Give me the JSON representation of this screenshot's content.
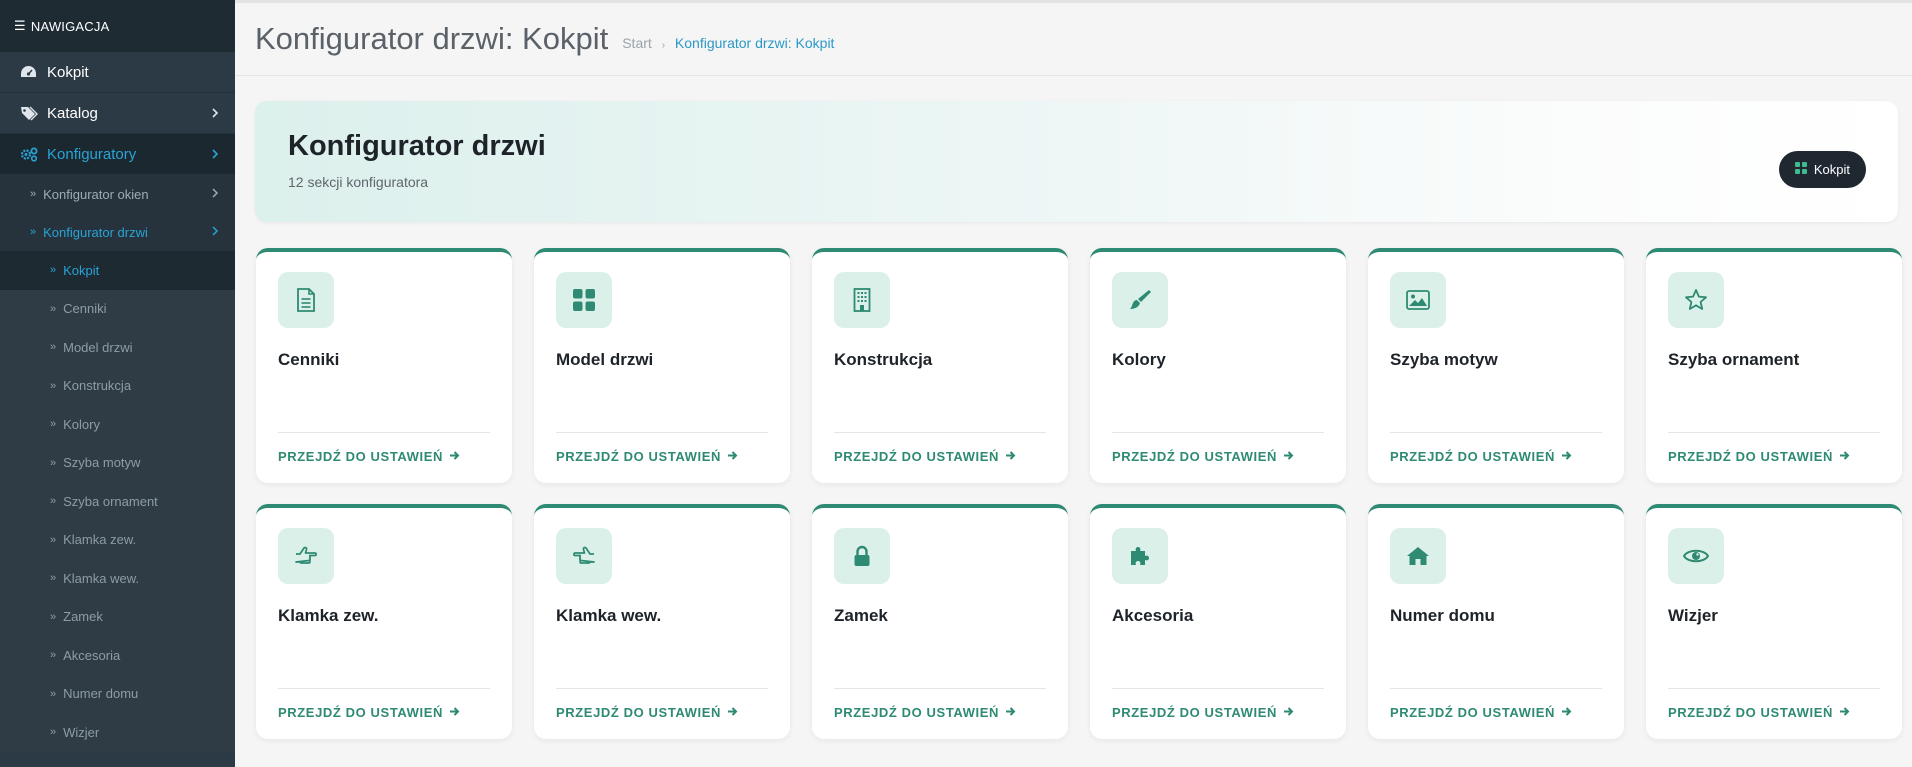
{
  "sidebar": {
    "header": "NAWIGACJA",
    "items": [
      {
        "label": "Kokpit"
      },
      {
        "label": "Katalog"
      },
      {
        "label": "Konfiguratory"
      }
    ],
    "sub_items": [
      {
        "label": "Konfigurator okien"
      },
      {
        "label": "Konfigurator drzwi"
      }
    ],
    "subsub_items": [
      {
        "label": "Kokpit"
      },
      {
        "label": "Cenniki"
      },
      {
        "label": "Model drzwi"
      },
      {
        "label": "Konstrukcja"
      },
      {
        "label": "Kolory"
      },
      {
        "label": "Szyba motyw"
      },
      {
        "label": "Szyba ornament"
      },
      {
        "label": "Klamka zew."
      },
      {
        "label": "Klamka wew."
      },
      {
        "label": "Zamek"
      },
      {
        "label": "Akcesoria"
      },
      {
        "label": "Numer domu"
      },
      {
        "label": "Wizjer"
      }
    ]
  },
  "header": {
    "title": "Konfigurator drzwi: Kokpit",
    "breadcrumb": {
      "home": "Start",
      "current": "Konfigurator drzwi: Kokpit"
    }
  },
  "hero": {
    "title": "Konfigurator drzwi",
    "subtitle": "12 sekcji konfiguratora",
    "button_label": "Kokpit"
  },
  "cards": [
    {
      "title": "Cenniki",
      "icon": "document-icon",
      "link": "PRZEJDŹ DO USTAWIEŃ"
    },
    {
      "title": "Model drzwi",
      "icon": "grid-icon",
      "link": "PRZEJDŹ DO USTAWIEŃ"
    },
    {
      "title": "Konstrukcja",
      "icon": "building-icon",
      "link": "PRZEJDŹ DO USTAWIEŃ"
    },
    {
      "title": "Kolory",
      "icon": "paintbrush-icon",
      "link": "PRZEJDŹ DO USTAWIEŃ"
    },
    {
      "title": "Szyba motyw",
      "icon": "image-icon",
      "link": "PRZEJDŹ DO USTAWIEŃ"
    },
    {
      "title": "Szyba ornament",
      "icon": "star-icon",
      "link": "PRZEJDŹ DO USTAWIEŃ"
    },
    {
      "title": "Klamka zew.",
      "icon": "hand-point-right-icon",
      "link": "PRZEJDŹ DO USTAWIEŃ"
    },
    {
      "title": "Klamka wew.",
      "icon": "hand-point-left-icon",
      "link": "PRZEJDŹ DO USTAWIEŃ"
    },
    {
      "title": "Zamek",
      "icon": "lock-icon",
      "link": "PRZEJDŹ DO USTAWIEŃ"
    },
    {
      "title": "Akcesoria",
      "icon": "puzzle-icon",
      "link": "PRZEJDŹ DO USTAWIEŃ"
    },
    {
      "title": "Numer domu",
      "icon": "home-icon",
      "link": "PRZEJDŹ DO USTAWIEŃ"
    },
    {
      "title": "Wizjer",
      "icon": "eye-icon",
      "link": "PRZEJDŹ DO USTAWIEŃ"
    }
  ],
  "colors": {
    "accent": "#2e8a72",
    "link": "#29a3d6",
    "sidebar": "#2c3a45"
  }
}
